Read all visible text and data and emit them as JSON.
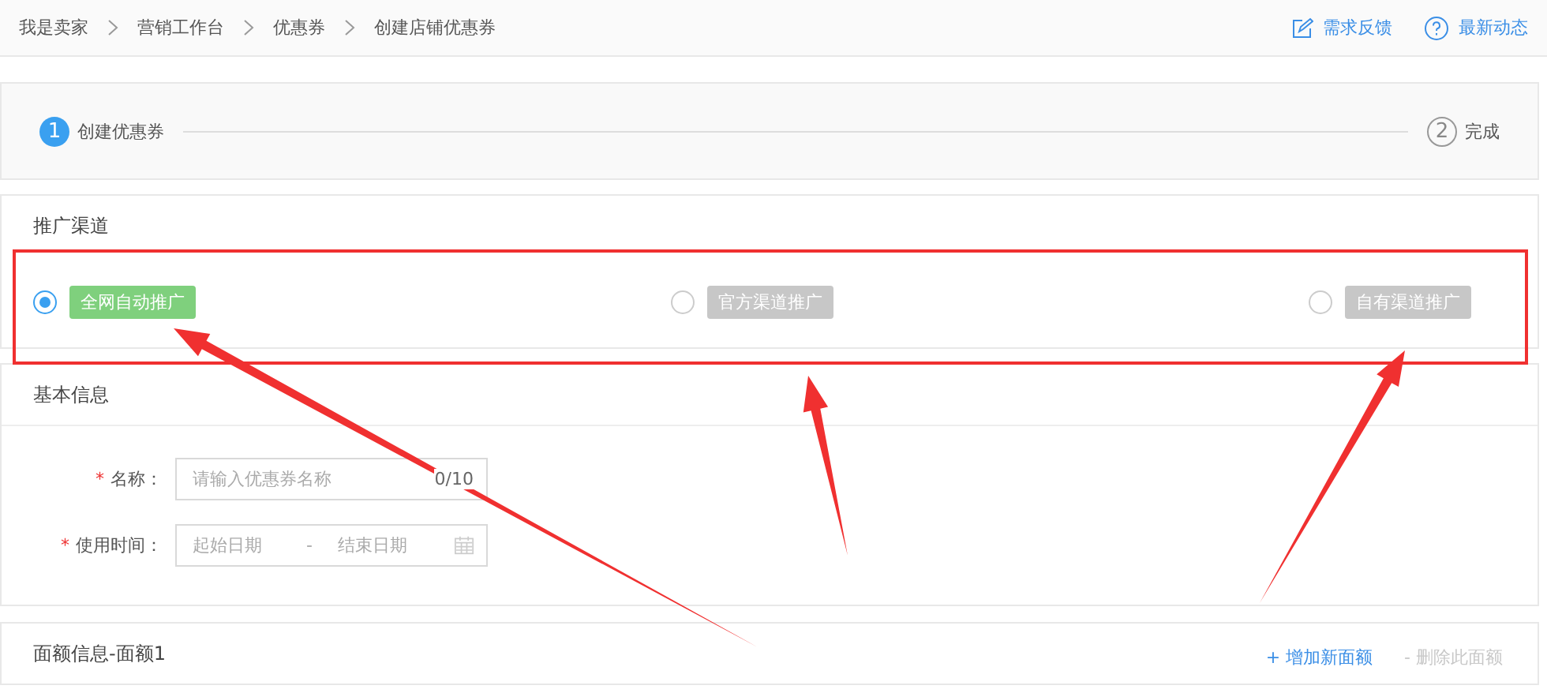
{
  "breadcrumb": [
    {
      "label": "我是卖家"
    },
    {
      "label": "营销工作台"
    },
    {
      "label": "优惠券"
    },
    {
      "label": "创建店铺优惠券"
    }
  ],
  "header_links": [
    {
      "kind": "feedback",
      "label": "需求反馈"
    },
    {
      "kind": "help",
      "label": "最新动态"
    }
  ],
  "steps": [
    {
      "number": "1",
      "label": "创建优惠券",
      "selected": true
    },
    {
      "number": "2",
      "label": "完成",
      "selected": false
    }
  ],
  "channel_section": {
    "title": "推广渠道",
    "options": [
      {
        "label": "全网自动推广",
        "selected": true
      },
      {
        "label": "官方渠道推广",
        "selected": false
      },
      {
        "label": "自有渠道推广",
        "selected": false
      }
    ]
  },
  "basic_info": {
    "title": "基本信息",
    "name_field": {
      "required_mark": "*",
      "label": "名称：",
      "placeholder": "请输入优惠券名称",
      "counter": "0/10"
    },
    "time_field": {
      "required_mark": "*",
      "label": "使用时间：",
      "start_placeholder": "起始日期",
      "separator": "-",
      "end_placeholder": "结束日期"
    }
  },
  "denomination": {
    "title": "面额信息-面额1",
    "actions": [
      {
        "label": "+ 增加新面额",
        "disabled": false
      },
      {
        "label": "- 删除此面额",
        "disabled": true
      }
    ]
  }
}
